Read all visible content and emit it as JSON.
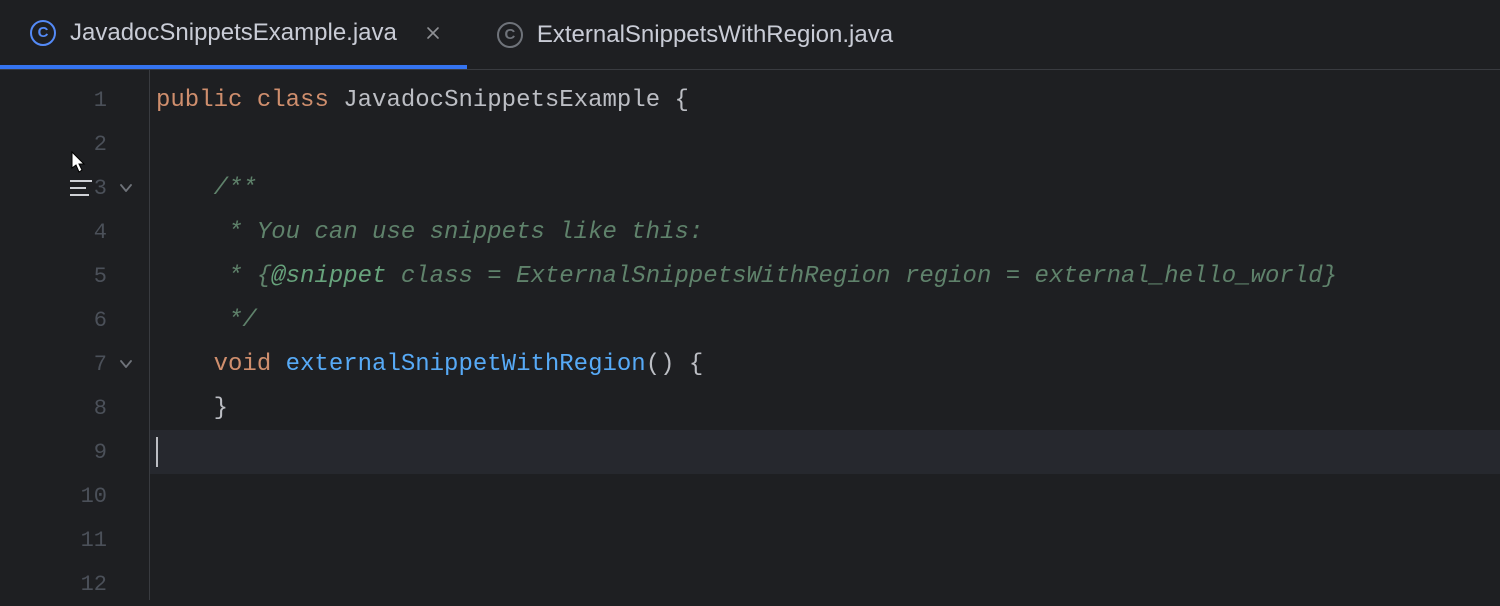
{
  "tabs": [
    {
      "label": "JavadocSnippetsExample.java",
      "icon_letter": "C",
      "active": true,
      "closeable": true
    },
    {
      "label": "ExternalSnippetsWithRegion.java",
      "icon_letter": "C",
      "active": false,
      "closeable": false
    }
  ],
  "gutter": {
    "line_numbers": [
      "1",
      "2",
      "3",
      "4",
      "5",
      "6",
      "7",
      "8",
      "9",
      "10",
      "11",
      "12"
    ],
    "render_icon_line": 3,
    "fold_chevron_lines": [
      3,
      7
    ]
  },
  "code": {
    "l1": {
      "kw1": "public",
      "sp1": " ",
      "kw2": "class",
      "sp2": " ",
      "cls": "JavadocSnippetsExample",
      "tail": " {"
    },
    "l2": "",
    "l3": {
      "indent": "    ",
      "doc": "/**"
    },
    "l4": {
      "indent": "     ",
      "doc": "* You can use snippets like this:"
    },
    "l5": {
      "indent": "     ",
      "pre": "* {",
      "tag": "@snippet",
      "rest": " class = ExternalSnippetsWithRegion region = external_hello_world}"
    },
    "l6": {
      "indent": "     ",
      "doc": "*/"
    },
    "l7": {
      "indent": "    ",
      "kw": "void",
      "sp": " ",
      "method": "externalSnippetWithRegion",
      "tail": "() {"
    },
    "l8": {
      "indent": "    ",
      "txt": "}"
    },
    "l9": "",
    "l10": "",
    "l11": "",
    "l12": ""
  },
  "current_line": 9
}
